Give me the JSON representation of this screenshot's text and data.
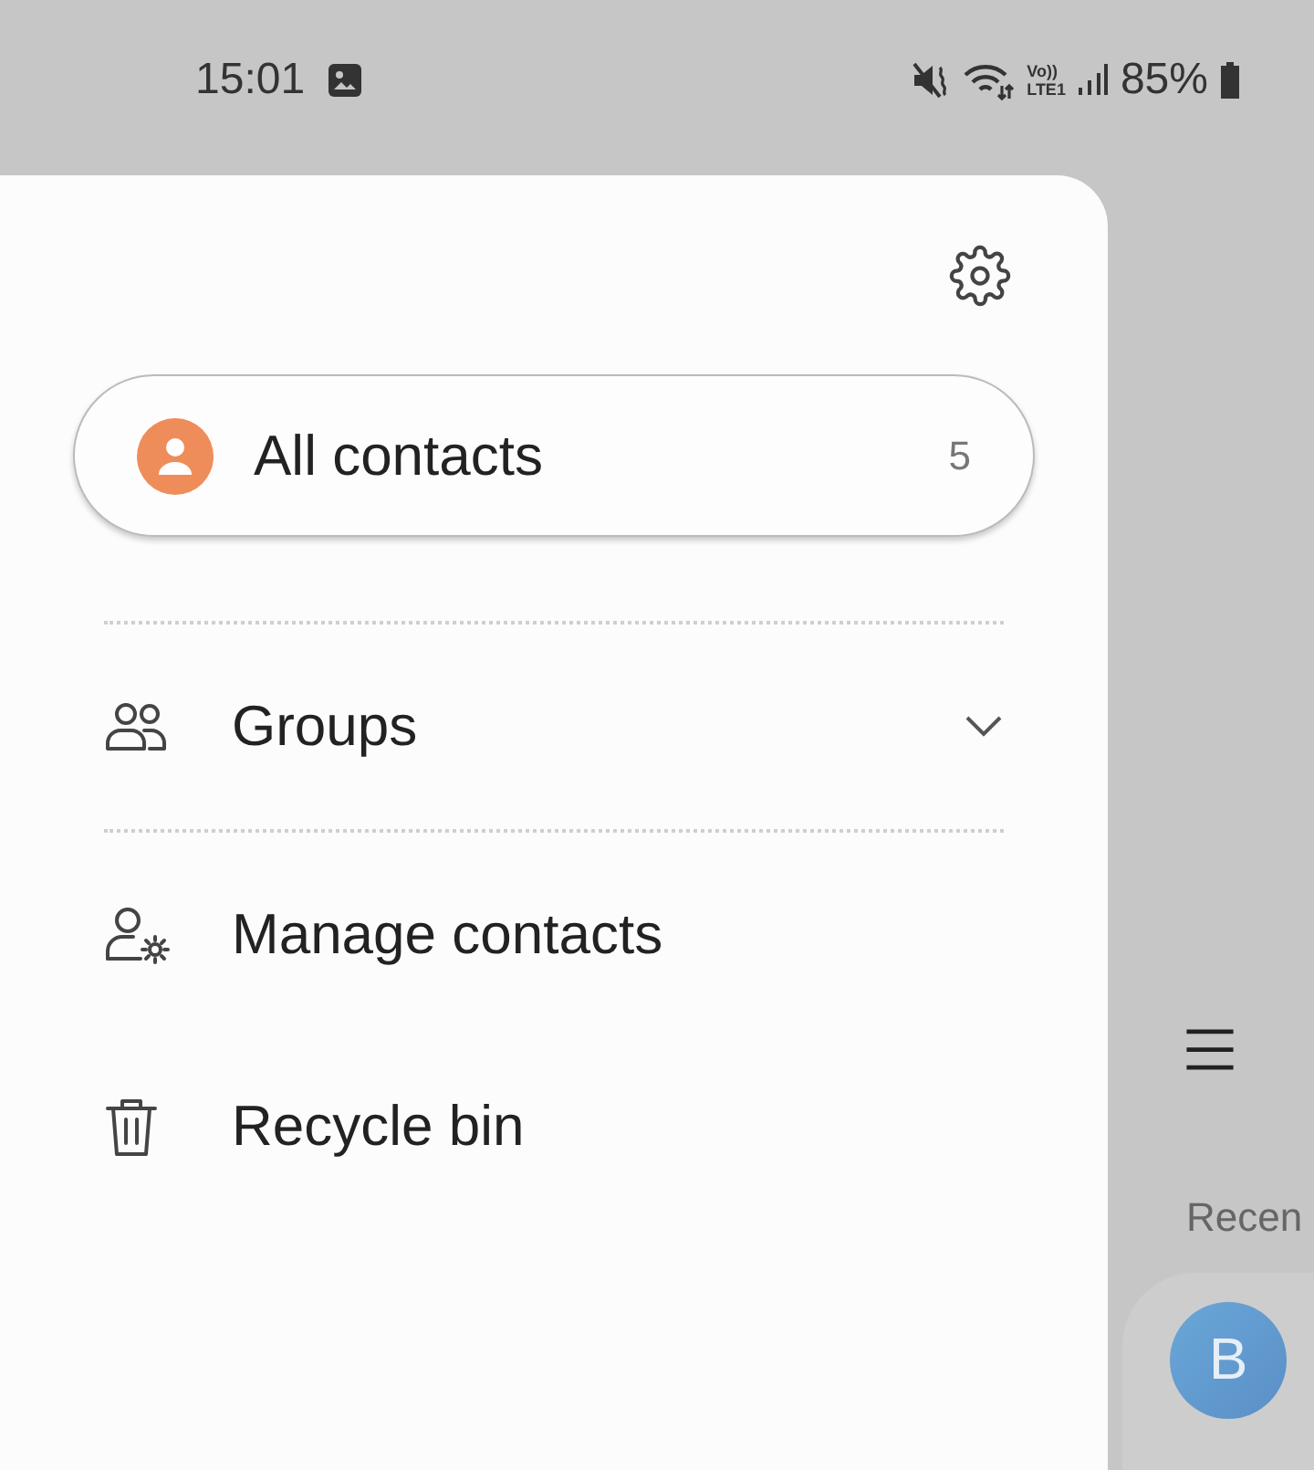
{
  "status_bar": {
    "time": "15:01",
    "volte_top": "Vo))",
    "volte_bottom": "LTE1",
    "battery": "85%"
  },
  "drawer": {
    "all_contacts": {
      "label": "All contacts",
      "count": "5",
      "selected": true
    },
    "items": [
      {
        "kind": "groups",
        "label": "Groups",
        "expanded": false
      },
      {
        "kind": "manage",
        "label": "Manage contacts"
      },
      {
        "kind": "recycle",
        "label": "Recycle bin"
      }
    ]
  },
  "background": {
    "section_title": "Recen",
    "avatar_letter": "B"
  }
}
